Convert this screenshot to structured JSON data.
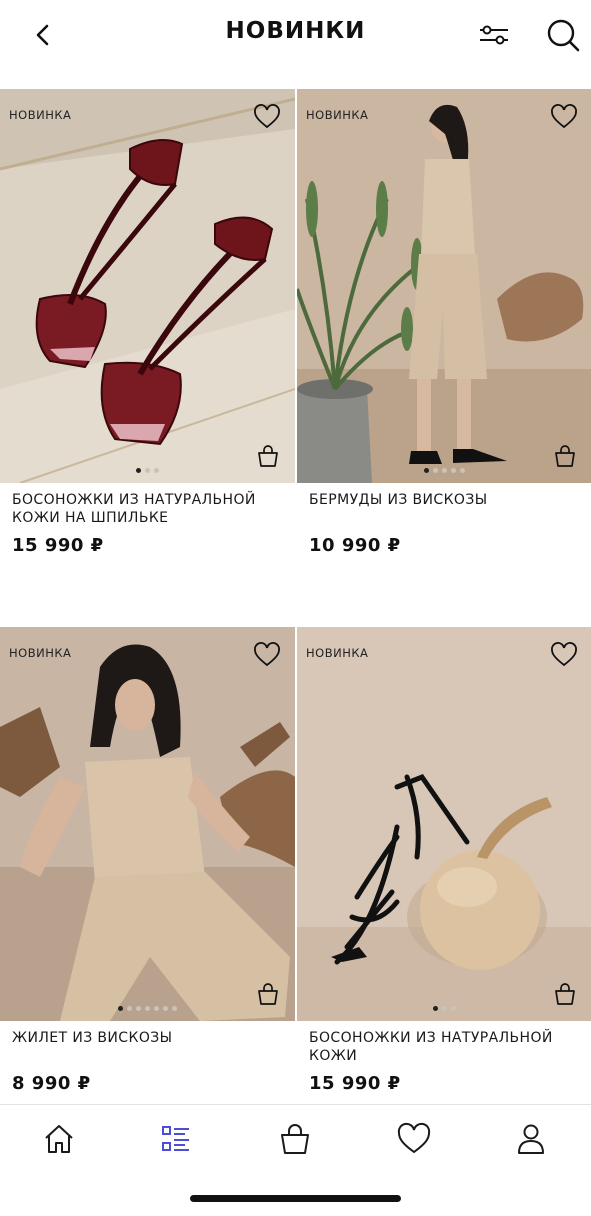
{
  "header": {
    "title": "НОВИНКИ",
    "back_icon": "chevron-left-icon",
    "filter_icon": "sliders-icon",
    "search_icon": "search-icon"
  },
  "products": [
    {
      "badge": "НОВИНКА",
      "name": "БОСОНОЖКИ ИЗ НАТУРАЛЬНОЙ КОЖИ НА ШПИЛЬКЕ",
      "price": "15 990 ₽",
      "dots": 3,
      "active_dot": 0,
      "image": "burgundy patent strappy sandals on stone"
    },
    {
      "badge": "НОВИНКА",
      "name": "БЕРМУДЫ ИЗ ВИСКОЗЫ",
      "price": "10 990 ₽",
      "dots": 5,
      "active_dot": 0,
      "image": "woman in beige bermuda shorts beside palm plant"
    },
    {
      "badge": "НОВИНКА",
      "name": "ЖИЛЕТ ИЗ ВИСКОЗЫ",
      "price": "8 990 ₽",
      "dots": 7,
      "active_dot": 0,
      "image": "woman in beige vest reclining on driftwood"
    },
    {
      "badge": "НОВИНКА",
      "name": "БОСОНОЖКИ ИЗ НАТУРАЛЬНОЙ КОЖИ",
      "price": "15 990 ₽",
      "dots": 3,
      "active_dot": 0,
      "image": "black strappy sandal next to round gourd"
    }
  ],
  "tabbar": {
    "items": [
      {
        "icon": "home-icon",
        "active": false
      },
      {
        "icon": "catalog-icon",
        "active": true
      },
      {
        "icon": "bag-icon",
        "active": false
      },
      {
        "icon": "heart-icon",
        "active": false
      },
      {
        "icon": "profile-icon",
        "active": false
      }
    ],
    "active_color": "#4B4FD6",
    "icon_color": "#1a1a1a"
  },
  "colors": {
    "background": "#ffffff",
    "text": "#111111"
  }
}
